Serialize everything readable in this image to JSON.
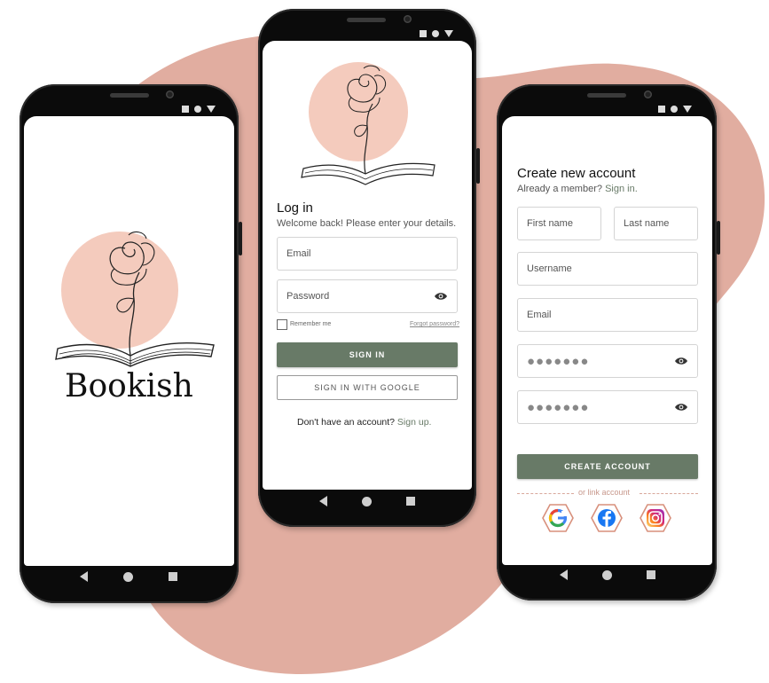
{
  "colors": {
    "blob": "#e1ada0",
    "accent_green": "#687a67",
    "peach": "#f4cbbd"
  },
  "splash": {
    "app_name": "Bookish"
  },
  "login": {
    "title": "Log in",
    "subtitle": "Welcome back! Please enter your details.",
    "email_placeholder": "Email",
    "password_placeholder": "Password",
    "remember_label": "Remember me",
    "forgot_label": "Forgot password?",
    "sign_in_label": "SIGN IN",
    "google_label": "SIGN IN WITH GOOGLE",
    "no_account_text": "Don't have an account?",
    "sign_up_link": "Sign up."
  },
  "signup": {
    "title": "Create new account",
    "member_text": "Already a member?",
    "sign_in_link": "Sign in.",
    "first_name_placeholder": "First name",
    "last_name_placeholder": "Last name",
    "username_placeholder": "Username",
    "email_placeholder": "Email",
    "password_mask": "●●●●●●●",
    "confirm_mask": "●●●●●●●",
    "create_label": "CREATE ACCOUNT",
    "or_link_text": "or link account",
    "social_icons": [
      "google-icon",
      "facebook-icon",
      "instagram-icon"
    ]
  }
}
